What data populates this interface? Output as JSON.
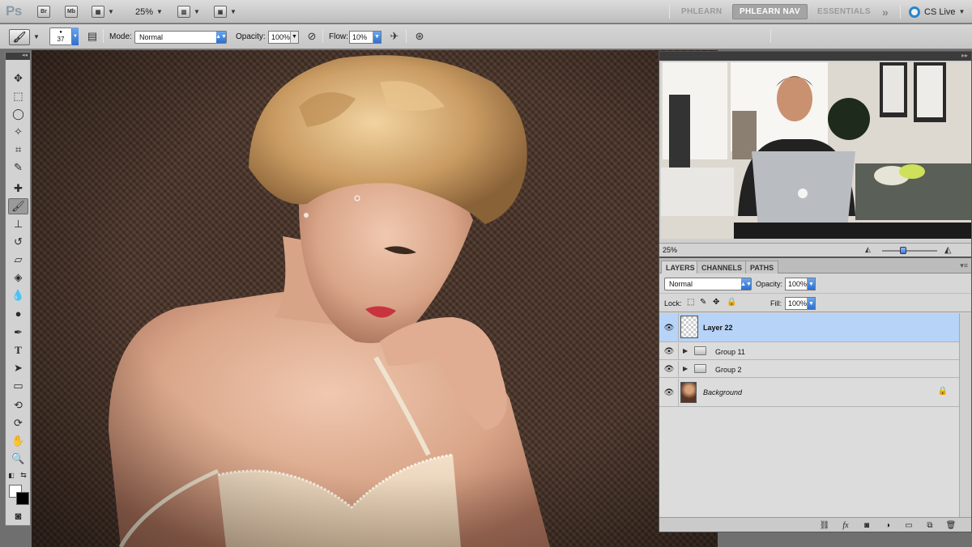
{
  "app": {
    "logo": "Ps",
    "bridge_label": "Br",
    "minibridge_label": "Mb",
    "zoom_level": "25%",
    "workspaces": [
      "PHLEARN",
      "PHLEARN NAV",
      "ESSENTIALS"
    ],
    "active_workspace": "PHLEARN NAV",
    "more_glyph": "»",
    "cs_live_label": "CS Live"
  },
  "options_bar": {
    "brush_size": "37",
    "mode_label": "Mode:",
    "mode_value": "Normal",
    "opacity_label": "Opacity:",
    "opacity_value": "100%",
    "flow_label": "Flow:",
    "flow_value": "10%"
  },
  "toolbox": {
    "active_tool": "brush",
    "tools": [
      "move",
      "marquee",
      "lasso",
      "quick-selection",
      "crop",
      "eyedropper",
      "healing-brush",
      "brush",
      "clone-stamp",
      "history-brush",
      "eraser",
      "paint-bucket",
      "blur",
      "dodge",
      "pen",
      "type",
      "path-selection",
      "shape",
      "3d-rotate",
      "3d-orbit",
      "hand",
      "zoom"
    ],
    "foreground_color": "#ffffff",
    "background_color": "#000000"
  },
  "navigator": {
    "zoom_level": "25%"
  },
  "layers_panel": {
    "tabs": [
      "LAYERS",
      "CHANNELS",
      "PATHS"
    ],
    "active_tab": "LAYERS",
    "blend_mode": "Normal",
    "opacity_label": "Opacity:",
    "opacity_value": "100%",
    "lock_label": "Lock:",
    "fill_label": "Fill:",
    "fill_value": "100%",
    "layers": [
      {
        "name": "Layer 22",
        "type": "pixel",
        "selected": true
      },
      {
        "name": "Group 11",
        "type": "group",
        "selected": false
      },
      {
        "name": "Group 2",
        "type": "group",
        "selected": false
      },
      {
        "name": "Background",
        "type": "background",
        "selected": false,
        "locked": true
      }
    ]
  },
  "colors": {
    "selection_blue": "#b7d3f7",
    "active_workspace_bg": "#a4a4a4",
    "cs_live_blue": "#2a86c9"
  }
}
